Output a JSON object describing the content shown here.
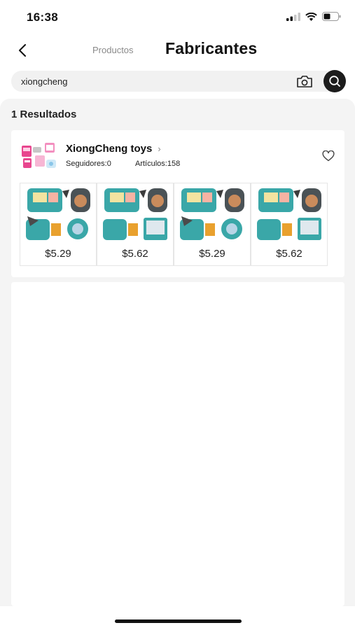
{
  "status_bar": {
    "time": "16:38"
  },
  "nav": {
    "tab_products": "Productos",
    "tab_manufacturers": "Fabricantes"
  },
  "search": {
    "value": "xiongcheng"
  },
  "results": {
    "count_label": "1 Resultados",
    "suppliers": [
      {
        "name": "XiongCheng toys",
        "followers": "Seguidores:0",
        "articles": "Artículos:158",
        "products": [
          {
            "price": "$5.29"
          },
          {
            "price": "$5.62"
          },
          {
            "price": "$5.29"
          },
          {
            "price": "$5.62"
          }
        ]
      }
    ]
  },
  "colors": {
    "accent_dark": "#1c1c1c",
    "teal_product": "#3aa7a8",
    "pink_logo": "#e8468e",
    "background_gray": "#f4f4f4"
  },
  "icons": {
    "back": "chevron-left-icon",
    "camera": "camera-icon",
    "search": "search-icon",
    "favorite": "heart-icon",
    "chevron": "chevron-right-icon"
  }
}
